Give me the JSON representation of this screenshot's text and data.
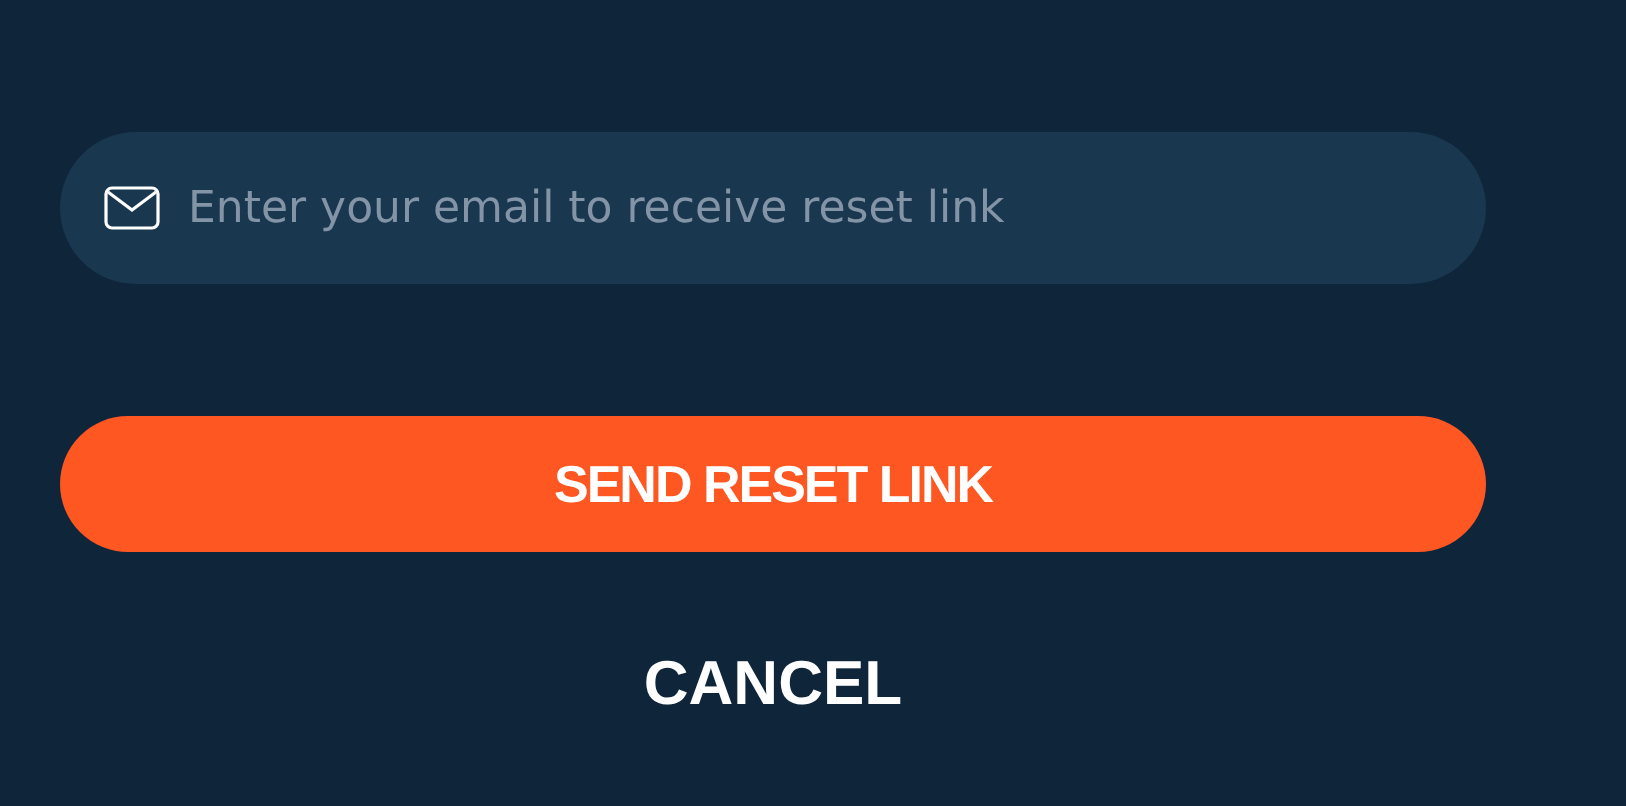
{
  "email_field": {
    "placeholder": "Enter your email to receive reset link"
  },
  "submit_button": {
    "label": "SEND RESET LINK"
  },
  "cancel_link": {
    "label": "CANCEL"
  }
}
